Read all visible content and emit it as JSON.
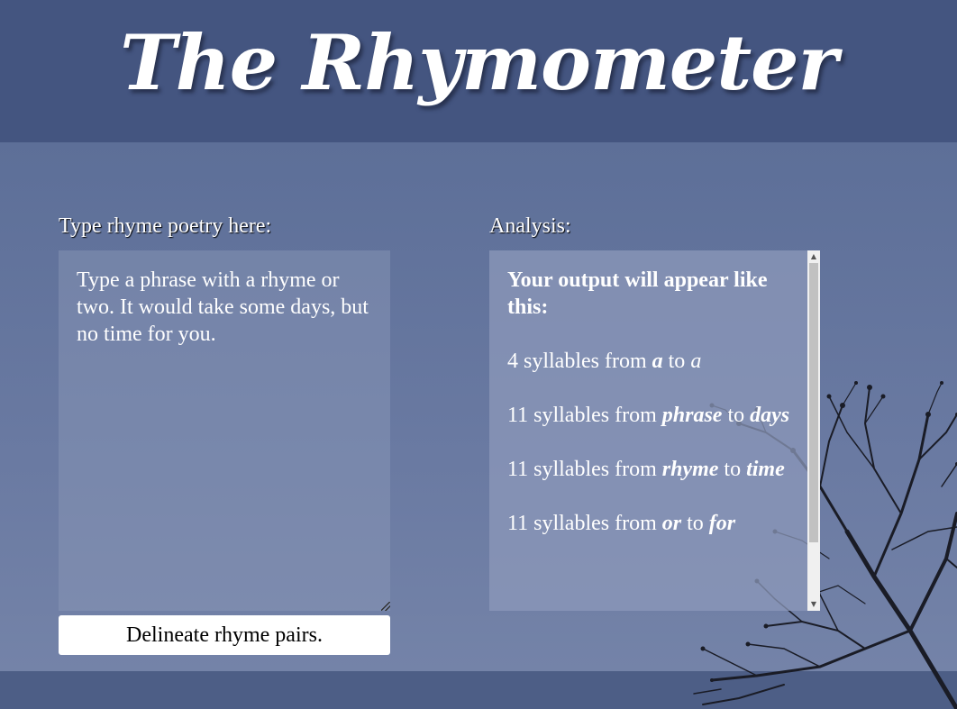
{
  "header": {
    "title": "The Rhymometer"
  },
  "input_panel": {
    "label": "Type rhyme poetry here:",
    "placeholder": "Type a phrase with a rhyme or two. It would take some days, but no time for you.",
    "button_label": "Delineate rhyme pairs."
  },
  "output_panel": {
    "label": "Analysis:",
    "heading": "Your output will appear like this:",
    "results": [
      {
        "prefix": "4 syllables from ",
        "from": "a",
        "mid": " to ",
        "to": "a"
      },
      {
        "prefix": "11 syllables from ",
        "from": "phrase",
        "mid": " to ",
        "to": "days"
      },
      {
        "prefix": "11 syllables from ",
        "from": "rhyme",
        "mid": " to ",
        "to": "time"
      },
      {
        "prefix": "11 syllables from ",
        "from": "or",
        "mid": " to ",
        "to": "for"
      }
    ]
  },
  "icons": {
    "scroll_up": "scroll-up-arrow-icon",
    "scroll_down": "scroll-down-arrow-icon",
    "background": "tree-silhouette"
  },
  "colors": {
    "header_bg": "#445580",
    "band_bg": "#6a7aa2",
    "text": "#ffffff"
  }
}
